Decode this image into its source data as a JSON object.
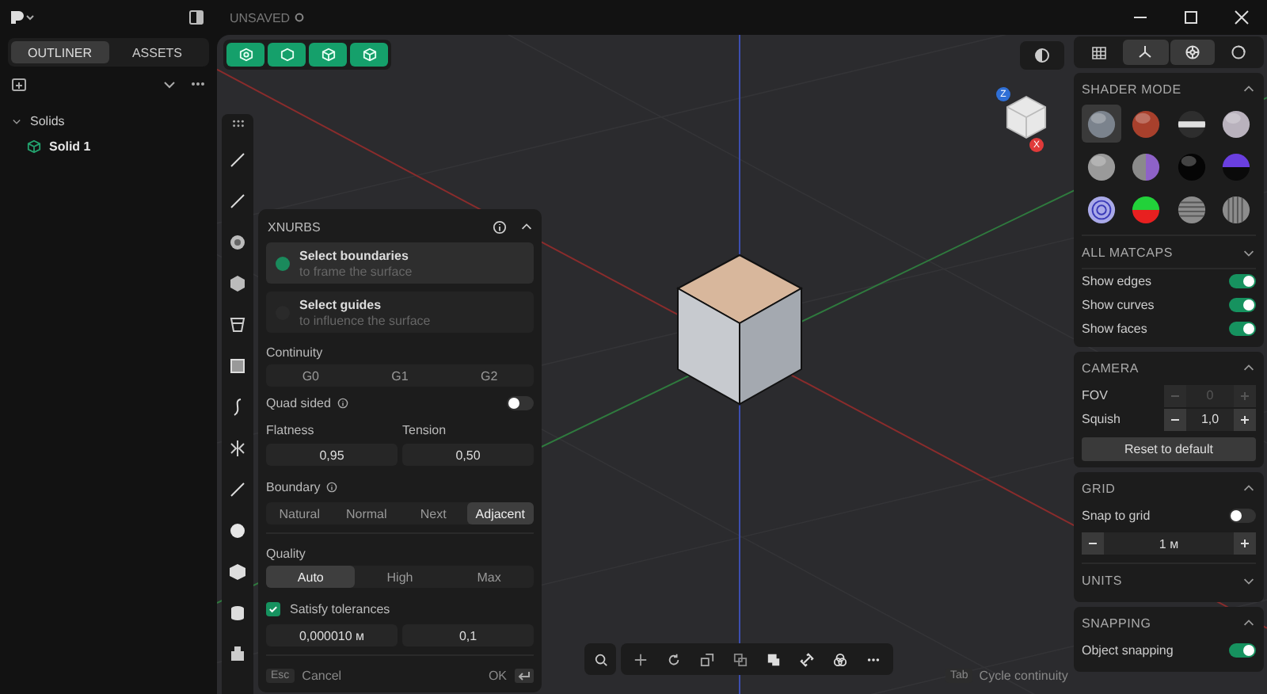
{
  "app": {
    "title": "UNSAVED"
  },
  "sidebar": {
    "tabs": [
      {
        "label": "OUTLINER",
        "selected": true
      },
      {
        "label": "ASSETS",
        "selected": false
      }
    ],
    "tree": [
      {
        "label": "Solids",
        "expanded": true,
        "children": [
          {
            "label": "Solid 1"
          }
        ]
      }
    ]
  },
  "xnurbs": {
    "title": "XNURBS",
    "steps": [
      {
        "title": "Select boundaries",
        "subtitle": "to frame the surface",
        "selected": true
      },
      {
        "title": "Select guides",
        "subtitle": "to influence the surface",
        "selected": false
      }
    ],
    "continuity": {
      "label": "Continuity",
      "options": [
        {
          "label": "G0",
          "selected": false
        },
        {
          "label": "G1",
          "selected": false
        },
        {
          "label": "G2",
          "selected": false
        }
      ]
    },
    "quad_sided": {
      "label": "Quad sided",
      "on": false
    },
    "params": [
      {
        "label": "Flatness",
        "value": "0,95"
      },
      {
        "label": "Tension",
        "value": "0,50"
      }
    ],
    "boundary": {
      "label": "Boundary",
      "options": [
        {
          "label": "Natural",
          "selected": false
        },
        {
          "label": "Normal",
          "selected": false
        },
        {
          "label": "Next",
          "selected": false
        },
        {
          "label": "Adjacent",
          "selected": true
        }
      ]
    },
    "quality": {
      "label": "Quality",
      "options": [
        {
          "label": "Auto",
          "selected": true
        },
        {
          "label": "High",
          "selected": false
        },
        {
          "label": "Max",
          "selected": false
        }
      ]
    },
    "satisfy_tolerances": {
      "label": "Satisfy tolerances",
      "checked": true
    },
    "tolerances": [
      "0,000010 м",
      "0,1"
    ],
    "footer": {
      "cancel_key": "Esc",
      "cancel": "Cancel",
      "ok": "OK"
    }
  },
  "view_cube": {
    "axes": [
      {
        "label": "Z",
        "color": "#2f6fd6"
      },
      {
        "label": "X",
        "color": "#e03a3a"
      }
    ]
  },
  "right_panel": {
    "tabs": [
      {
        "selected": false
      },
      {
        "selected": true
      },
      {
        "selected": true
      },
      {
        "selected": false
      }
    ],
    "shader_mode": {
      "title": "SHADER MODE",
      "expanded": true,
      "matcaps": [
        {
          "kind": "sphere",
          "color": "#7b838d",
          "selected": true
        },
        {
          "kind": "sphere",
          "color": "#a8402c",
          "selected": false
        },
        {
          "kind": "band",
          "color": "#2e2e2e",
          "selected": false
        },
        {
          "kind": "sphere",
          "color": "#b9b2bd",
          "selected": false
        },
        {
          "kind": "sphere",
          "color": "#9a9a9a",
          "selected": false
        },
        {
          "kind": "split-v",
          "halves": [
            {
              "color": "#8a8a8a"
            },
            {
              "color": "#8e62c8"
            }
          ],
          "selected": false
        },
        {
          "kind": "sphere",
          "color": "#050505",
          "selected": false
        },
        {
          "kind": "split-h",
          "halves": [
            {
              "color": "#6a3fe0"
            },
            {
              "color": "#0a0a0a"
            }
          ],
          "selected": false
        },
        {
          "kind": "rings",
          "color": "#a9a9e8",
          "selected": false
        },
        {
          "kind": "split-h",
          "halves": [
            {
              "color": "#22d13a"
            },
            {
              "color": "#e82020"
            }
          ],
          "selected": false
        },
        {
          "kind": "stripes-h",
          "color": "#8c8c8c",
          "selected": false
        },
        {
          "kind": "stripes-v",
          "color": "#8c8c8c",
          "selected": false
        }
      ]
    },
    "all_matcaps": {
      "title": "ALL MATCAPS",
      "expanded": false
    },
    "display": [
      {
        "label": "Show edges",
        "on": true
      },
      {
        "label": "Show curves",
        "on": true
      },
      {
        "label": "Show faces",
        "on": true
      }
    ],
    "camera": {
      "title": "CAMERA",
      "expanded": true,
      "fields": [
        {
          "label": "FOV",
          "value": "0",
          "disabled": true
        },
        {
          "label": "Squish",
          "value": "1,0",
          "disabled": false
        }
      ],
      "reset": "Reset to default"
    },
    "grid": {
      "title": "GRID",
      "expanded": true,
      "snap": {
        "label": "Snap to grid",
        "on": false
      },
      "size": "1 м"
    },
    "units": {
      "title": "UNITS",
      "expanded": false
    },
    "snapping": {
      "title": "SNAPPING",
      "expanded": true,
      "items": [
        {
          "label": "Object snapping",
          "on": true
        }
      ]
    }
  },
  "hint": {
    "key": "Tab",
    "text": "Cycle continuity"
  }
}
